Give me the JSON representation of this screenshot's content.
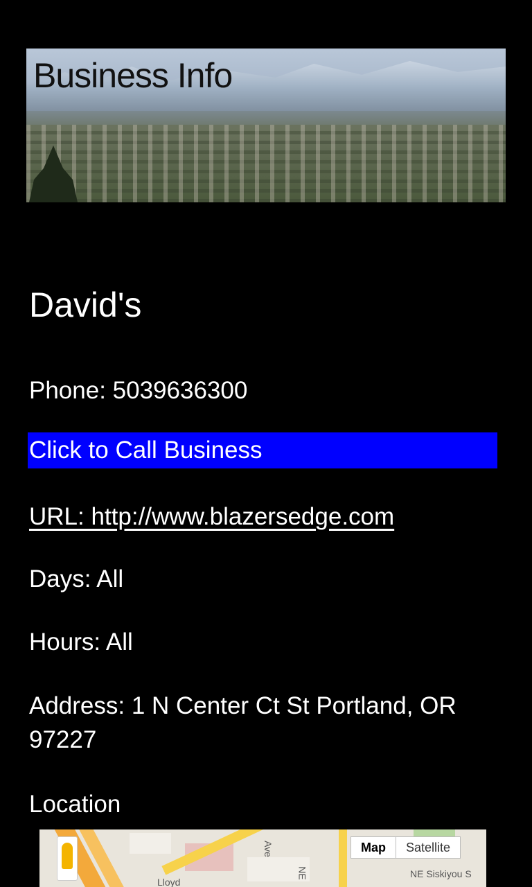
{
  "header": {
    "title": "Business Info"
  },
  "business": {
    "name": "David's",
    "phone": "Phone: 5039636300",
    "call_button": "Click to Call Business",
    "url": "URL: http://www.blazersedge.com",
    "days": "Days: All",
    "hours": "Hours: All",
    "address": "Address: 1 N Center Ct St Portland, OR 97227",
    "location_label": "Location"
  },
  "map": {
    "map_button": "Map",
    "satellite_button": "Satellite",
    "street_label": "NE Siskiyou S",
    "label_ave": "Ave",
    "label_ne": "NE",
    "label_lloyd": "Lloyd"
  },
  "colors": {
    "call_button_bg": "#0000ff",
    "background": "#000000"
  }
}
